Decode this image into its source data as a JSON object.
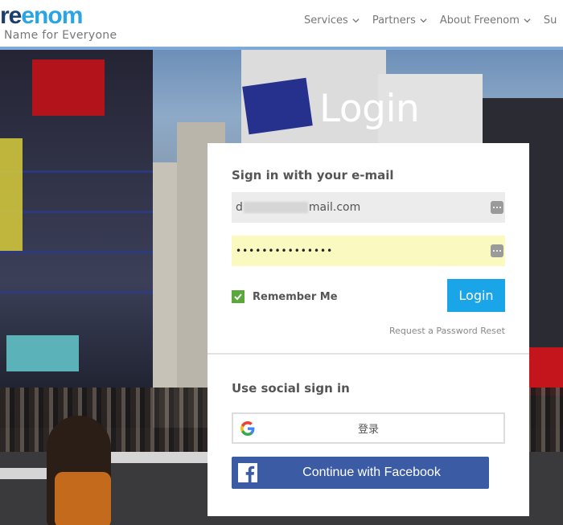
{
  "header": {
    "logo_dark": "re",
    "logo_blue": "enom",
    "tagline": "Name for Everyone",
    "nav": [
      "Services",
      "Partners",
      "About Freenom",
      "Su"
    ]
  },
  "hero": {
    "title": "Login"
  },
  "signin": {
    "heading": "Sign in with your e-mail",
    "email_prefix": "d",
    "email_suffix": "mail.com",
    "password_masked": "•••••••••••••••",
    "remember_label": "Remember Me",
    "remember_checked": true,
    "login_label": "Login",
    "reset_link": "Request a Password Reset"
  },
  "social": {
    "heading": "Use social sign in",
    "google_label": "登录",
    "facebook_label": "Continue with Facebook"
  },
  "colors": {
    "brand_blue": "#1aa5e9",
    "facebook_blue": "#3b5ba5",
    "check_green": "#5aa83b",
    "logo_navy": "#1d3d6b"
  }
}
